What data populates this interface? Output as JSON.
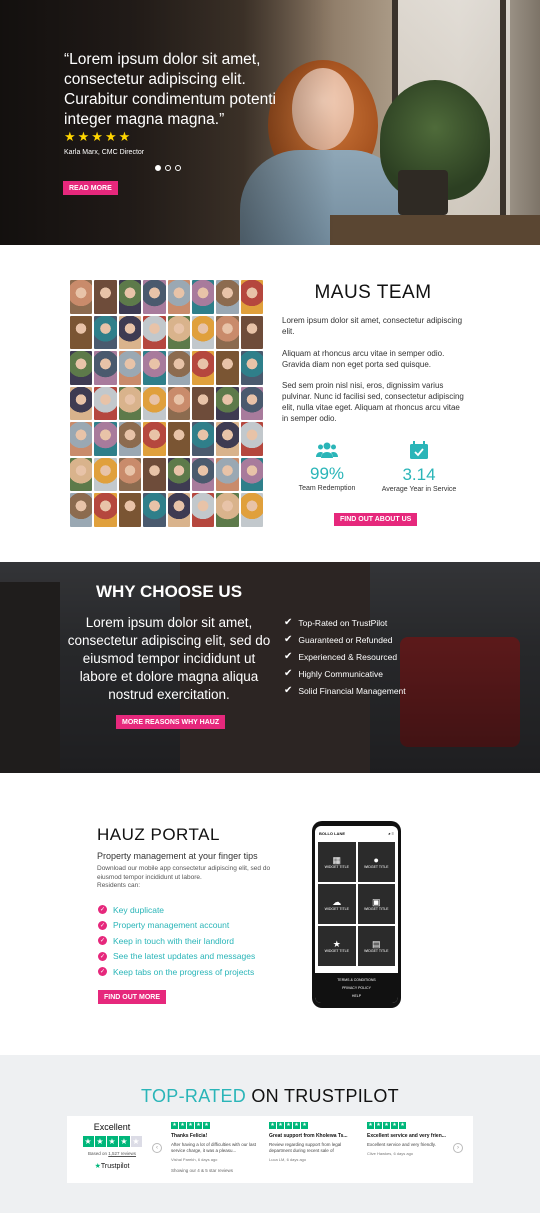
{
  "hero": {
    "quote": "“Lorem ipsum dolor sit amet, consectetur adipiscing elit. Curabitur condimentum potenti integer magna magna.”",
    "stars": "★★★★★",
    "author": "Karla Marx, CMC Director",
    "button": "READ MORE"
  },
  "team": {
    "title": "MAUS TEAM",
    "p1": "Lorem ipsum dolor sit amet, consectetur adipiscing elit.",
    "p2": "Aliquam at rhoncus arcu vitae in semper odio. Gravida diam non eget porta sed quisque.",
    "p3": "Sed sem proin nisl nisi, eros, dignissim varius pulvinar. Nunc id facilisi sed, consectetur adipiscing elit, nulla vitae eget. Aliquam at rhoncus arcu vitae in semper odio.",
    "stats": [
      {
        "value": "99%",
        "label": "Team Redemption",
        "icon": "people-icon"
      },
      {
        "value": "3.14",
        "label": "Average Year in Service",
        "icon": "calendar-check-icon"
      }
    ],
    "button": "FIND OUT ABOUT US"
  },
  "why": {
    "title": "WHY CHOOSE US",
    "body": "Lorem ipsum dolor sit amet, consectetur adipiscing elit, sed do eiusmod tempor incididunt ut labore et dolore magna aliqua nostrud exercitation.",
    "points": [
      "Top-Rated on TrustPilot",
      "Guaranteed or Refunded",
      "Experienced & Resourced",
      "Highly Communicative",
      "Solid Financial Management"
    ],
    "button": "MORE REASONS WHY HAUZ"
  },
  "portal": {
    "title": "HAUZ PORTAL",
    "subtitle": "Property management at your finger tips",
    "desc1": "Download our mobile app consectetur adipiscing elit, sed do eiusmod tempor incididunt ut labore.",
    "desc2": "Residents can:",
    "features": [
      "Key duplicate",
      "Property management account",
      "Keep in touch with their landlord",
      "See the latest updates and messages",
      "Keep tabs on the progress of projects"
    ],
    "button": "FIND OUT MORE",
    "phone": {
      "brand": "BOLLO LANE",
      "tile_label": "WIDGET TITLE",
      "links": [
        "TERMS & CONDITIONS",
        "PRIVACY POLICY",
        "HELP"
      ]
    }
  },
  "trust": {
    "title_accent": "TOP-RATED",
    "title_rest": " ON TRUSTPILOT",
    "rating_word": "Excellent",
    "based_prefix": "Based on ",
    "based_link": "1,527 reviews",
    "logo": "Trustpilot",
    "showing": "Showing our 4 & 5 star reviews",
    "reviews": [
      {
        "title": "Thanks Felicia!",
        "body": "After having a lot of difficulties with our last service charge, it was a pleasu...",
        "meta": "Vishal Parekh, 6 days ago"
      },
      {
        "title": "Great support from Kholewa Ts...",
        "body": "Review regarding support from legal department during recent sale of",
        "meta": "Luca LM, 6 days ago"
      },
      {
        "title": "Excellent service and very frien...",
        "body": "Excellent service and very friendly.",
        "meta": "Clive Hawkes, 6 days ago"
      }
    ]
  },
  "colors": {
    "accent_pink": "#e6287c",
    "accent_teal": "#2ab5b8",
    "trustpilot_green": "#00b67a"
  }
}
